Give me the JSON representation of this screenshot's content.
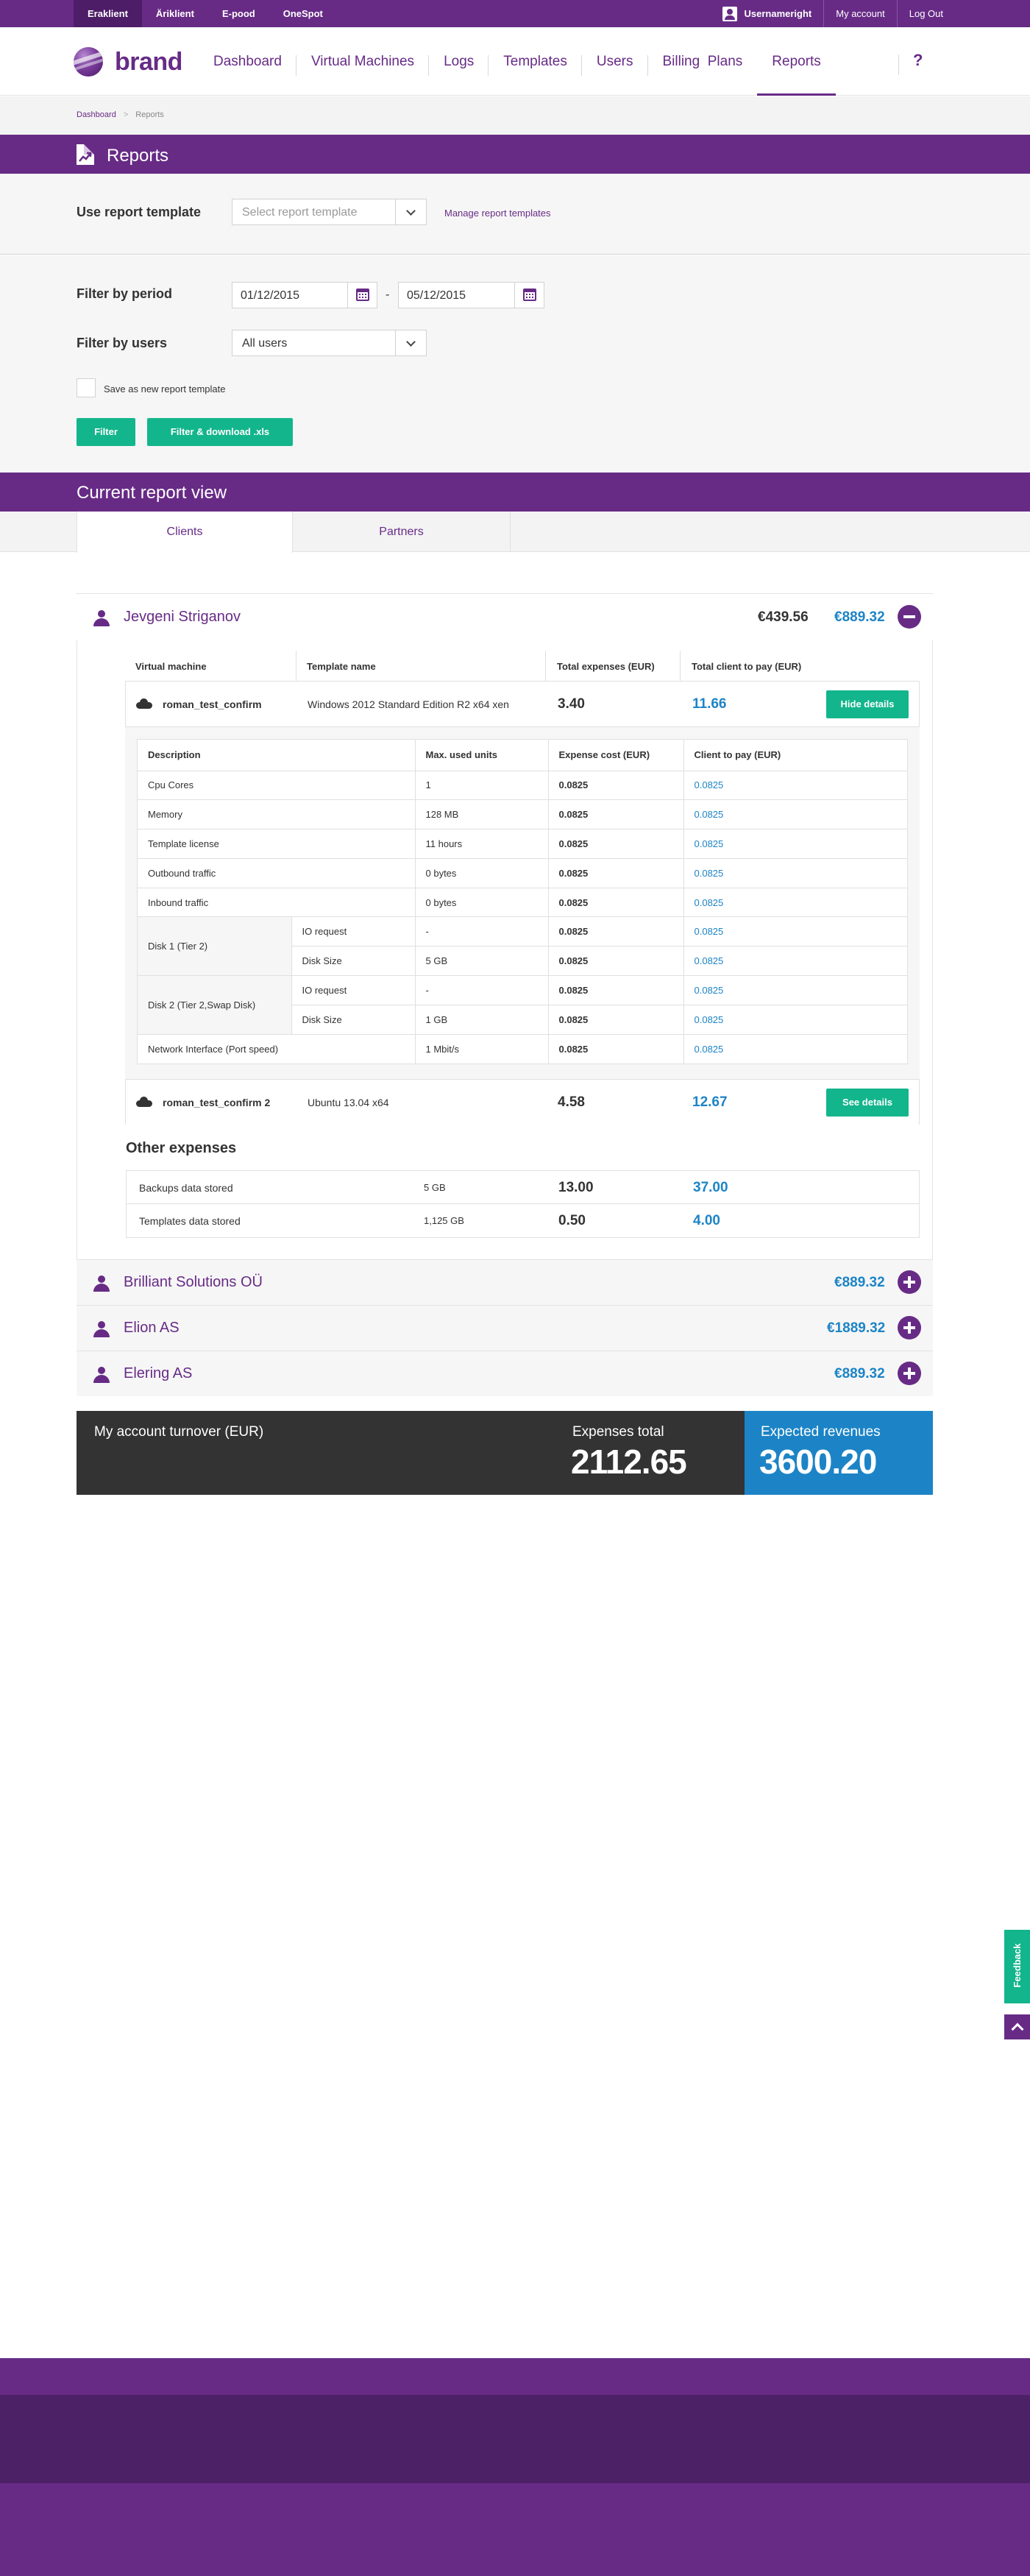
{
  "topbar": {
    "tabs": [
      "Eraklient",
      "Äriklient",
      "E-pood",
      "OneSpot"
    ],
    "active_tab": "Eraklient",
    "username": "Usernameright",
    "my_account": "My account",
    "logout": "Log Out"
  },
  "brand": "brand",
  "nav": {
    "items": [
      "Dashboard",
      "Virtual Machines",
      "Logs",
      "Templates",
      "Users",
      "Billing  Plans",
      "Reports"
    ],
    "active": "Reports",
    "help": "?"
  },
  "breadcrumb": [
    "Dashboard",
    "Reports"
  ],
  "page_title": "Reports",
  "template": {
    "label": "Use report template",
    "placeholder": "Select report template",
    "manage_link": "Manage report templates"
  },
  "filter": {
    "period_label": "Filter by period",
    "date_from": "01/12/2015",
    "dash": "-",
    "date_to": "05/12/2015",
    "users_label": "Filter by users",
    "users_value": "All users",
    "save_template_label": "Save as new report template",
    "filter_button": "Filter",
    "download_button": "Filter & download .xls"
  },
  "current_view": {
    "title": "Current report view",
    "tabs": [
      "Clients",
      "Partners"
    ],
    "active_tab": "Clients"
  },
  "clients": [
    {
      "name": "Jevgeni Striganov",
      "expenses": "€439.56",
      "total": "€889.32",
      "expanded": true
    },
    {
      "name": "Brilliant Solutions OÜ",
      "total": "€889.32",
      "expanded": false
    },
    {
      "name": "Elion AS",
      "total": "€1889.32",
      "expanded": false
    },
    {
      "name": "Elering AS",
      "total": "€889.32",
      "expanded": false
    }
  ],
  "vm_table": {
    "headers": [
      "Virtual machine",
      "Template name",
      "Total expenses (EUR)",
      "Total client to pay (EUR)"
    ],
    "rows": [
      {
        "name": "roman_test_confirm",
        "template": "Windows 2012 Standard Edition R2 x64 xen",
        "expenses": "3.40",
        "pay": "11.66",
        "button": "Hide details"
      },
      {
        "name": "roman_test_confirm 2",
        "template": "Ubuntu 13.04 x64",
        "expenses": "4.58",
        "pay": "12.67",
        "button": "See details"
      }
    ]
  },
  "details": {
    "headers": [
      "Description",
      "Max. used units",
      "Expense cost (EUR)",
      "Client to pay (EUR)"
    ],
    "rows": [
      {
        "desc": "Cpu Cores",
        "units": "1",
        "cost": "0.0825",
        "pay": "0.0825"
      },
      {
        "desc": "Memory",
        "units": "128 MB",
        "cost": "0.0825",
        "pay": "0.0825"
      },
      {
        "desc": "Template license",
        "units": "11 hours",
        "cost": "0.0825",
        "pay": "0.0825"
      },
      {
        "desc": "Outbound traffic",
        "units": "0 bytes",
        "cost": "0.0825",
        "pay": "0.0825"
      },
      {
        "desc": "Inbound traffic",
        "units": "0 bytes",
        "cost": "0.0825",
        "pay": "0.0825"
      }
    ],
    "disk1": {
      "label": "Disk 1 (Tier 2)",
      "rows": [
        {
          "sub": "IO request",
          "units": "-",
          "cost": "0.0825",
          "pay": "0.0825"
        },
        {
          "sub": "Disk Size",
          "units": "5 GB",
          "cost": "0.0825",
          "pay": "0.0825"
        }
      ]
    },
    "disk2": {
      "label": "Disk 2 (Tier 2,Swap Disk)",
      "rows": [
        {
          "sub": "IO request",
          "units": "-",
          "cost": "0.0825",
          "pay": "0.0825"
        },
        {
          "sub": "Disk Size",
          "units": "1 GB",
          "cost": "0.0825",
          "pay": "0.0825"
        }
      ]
    },
    "network": {
      "desc": "Network Interface (Port speed)",
      "units": "1 Mbit/s",
      "cost": "0.0825",
      "pay": "0.0825"
    }
  },
  "other_expenses": {
    "title": "Other expenses",
    "rows": [
      {
        "desc": "Backups data stored",
        "units": "5 GB",
        "expenses": "13.00",
        "pay": "37.00"
      },
      {
        "desc": "Templates data stored",
        "units": "1,125 GB",
        "expenses": "0.50",
        "pay": "4.00"
      }
    ]
  },
  "turnover": {
    "label": "My account turnover (EUR)",
    "expenses_label": "Expenses total",
    "expenses_value": "2112.65",
    "revenues_label": "Expected revenues",
    "revenues_value": "3600.20"
  },
  "feedback": "Feedback",
  "colors": {
    "brand": "#672b86",
    "accent_green": "#13b58c",
    "accent_blue": "#1c84c6",
    "dark": "#333333"
  }
}
